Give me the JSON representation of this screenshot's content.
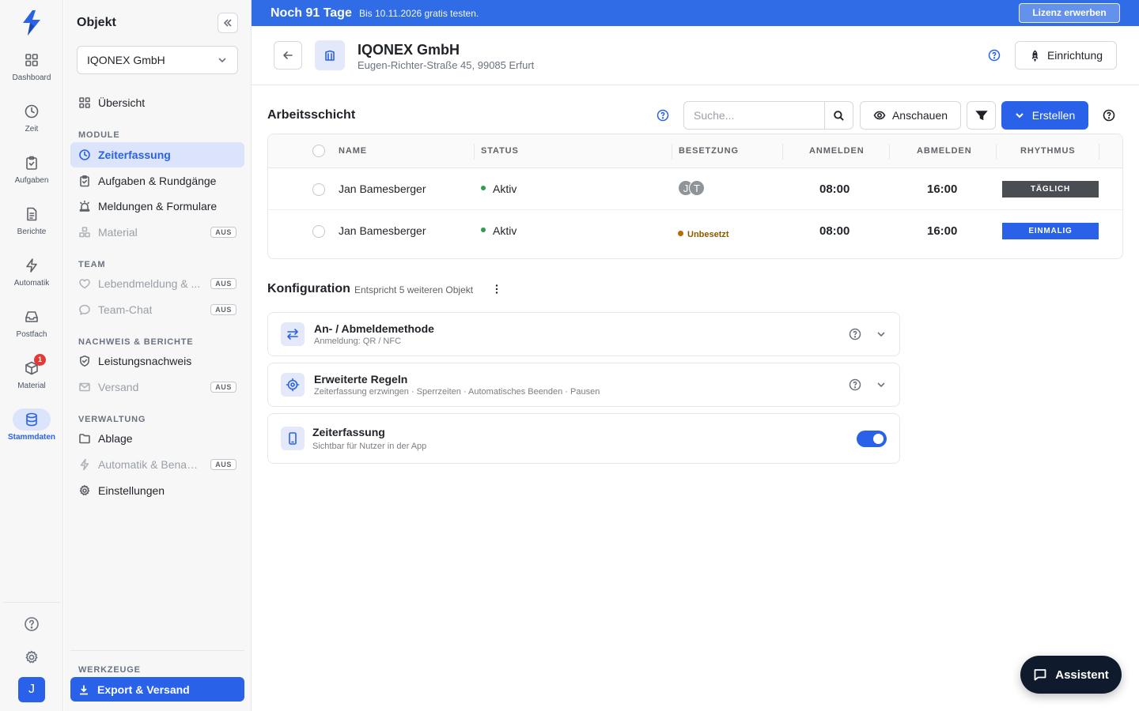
{
  "rail": {
    "items": [
      {
        "label": "Dashboard"
      },
      {
        "label": "Zeit"
      },
      {
        "label": "Aufgaben"
      },
      {
        "label": "Berichte"
      },
      {
        "label": "Automatik"
      },
      {
        "label": "Postfach"
      },
      {
        "label": "Material",
        "badge": "1"
      },
      {
        "label": "Stammdaten"
      }
    ],
    "user_initial": "J"
  },
  "sidebar": {
    "title": "Objekt",
    "selected_object": "IQONEX GmbH",
    "overview": "Übersicht",
    "sections": {
      "module": "MODULE",
      "team": "TEAM",
      "nachweis": "NACHWEIS & BERICHTE",
      "verwaltung": "VERWALTUNG",
      "werkzeuge": "WERKZEUGE"
    },
    "items": {
      "zeiterfassung": "Zeiterfassung",
      "aufgaben": "Aufgaben & Rundgänge",
      "meldungen": "Meldungen & Formulare",
      "material": "Material",
      "lebendmeldung": "Lebendmeldung & ...",
      "teamchat": "Team-Chat",
      "leistungsnachweis": "Leistungsnachweis",
      "versand": "Versand",
      "ablage": "Ablage",
      "automatik": "Automatik & Benac...",
      "einstellungen": "Einstellungen"
    },
    "off_badge": "AUS",
    "export": "Export & Versand"
  },
  "banner": {
    "title": "Noch 91 Tage",
    "subtitle": "Bis 10.11.2026 gratis testen.",
    "button": "Lizenz erwerben"
  },
  "header": {
    "title": "IQONEX GmbH",
    "address": "Eugen-Richter-Straße 45, 99085 Erfurt",
    "setup_button": "Einrichtung"
  },
  "shifts": {
    "title": "Arbeitsschicht",
    "search_placeholder": "Suche...",
    "view_button": "Anschauen",
    "create_button": "Erstellen",
    "columns": [
      "NAME",
      "STATUS",
      "BESETZUNG",
      "ANMELDEN",
      "ABMELDEN",
      "RHYTHMUS"
    ],
    "rows": [
      {
        "name": "Jan Bamesberger",
        "status": "Aktiv",
        "staffing": [
          "J",
          "T"
        ],
        "start": "08:00",
        "end": "16:00",
        "rhythm": "TÄGLICH",
        "rhythm_color": "#4a4d52"
      },
      {
        "name": "Jan Bamesberger",
        "status": "Aktiv",
        "staffing_text": "Unbesetzt",
        "start": "08:00",
        "end": "16:00",
        "rhythm": "EINMALIG",
        "rhythm_color": "#2962e8"
      }
    ]
  },
  "config": {
    "title": "Konfiguration",
    "subtitle": "Entspricht 5 weiteren Objekt",
    "cards": [
      {
        "title": "An- / Abmeldemethode",
        "subtitle": "Anmeldung: QR / NFC"
      },
      {
        "title": "Erweiterte Regeln",
        "subtitle": "Zeiterfassung erzwingen · Sperrzeiten · Automatisches Beenden · Pausen"
      },
      {
        "title": "Zeiterfassung",
        "subtitle": "Sichtbar für Nutzer in der App",
        "enabled": true
      }
    ]
  },
  "assistant": {
    "label": "Assistent"
  },
  "colors": {
    "accent": "#2962e8",
    "banner": "#2f6ce5",
    "active_bg": "#dbe4fb",
    "assistant_bg": "#0f1b2d"
  }
}
